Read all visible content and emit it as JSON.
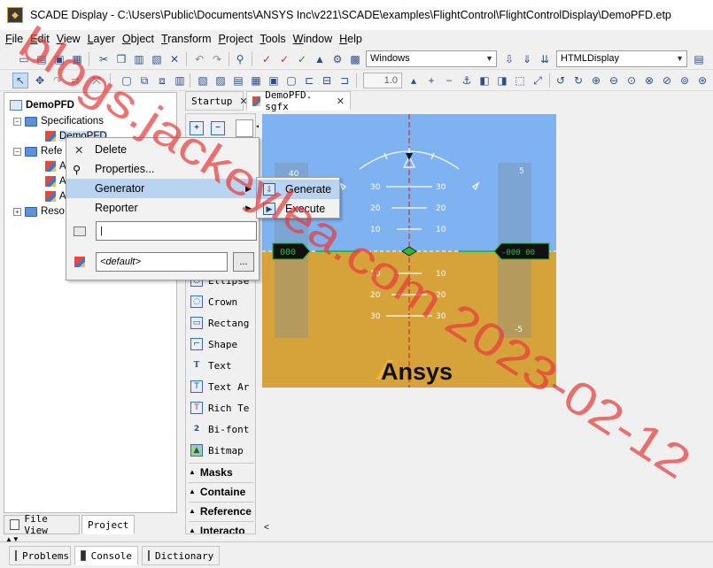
{
  "window": {
    "title": "SCADE Display - C:\\Users\\Public\\Documents\\ANSYS Inc\\v221\\SCADE\\examples\\FlightControl\\FlightControlDisplay\\DemoPFD.etp"
  },
  "menubar": [
    "File",
    "Edit",
    "View",
    "Layer",
    "Object",
    "Transform",
    "Project",
    "Tools",
    "Window",
    "Help"
  ],
  "toolbar": {
    "platform_combo": "Windows",
    "target_combo": "HTMLDisplay",
    "zoom_value": "1.0"
  },
  "project_tree": {
    "root": "DemoPFD",
    "specifications": "Specifications",
    "spec_item": "DemoPFD",
    "references_truncated": "Refe",
    "resources_truncated": "Reso",
    "ref_item_letter": "A"
  },
  "left_tabs": {
    "file_view": "File View",
    "project": "Project"
  },
  "editor_tabs": [
    {
      "label": "Startup"
    },
    {
      "label": "DemoPFD. sgfx"
    }
  ],
  "palette": {
    "items": [
      "Ellipse",
      "Crown",
      "Rectangle",
      "Shape",
      "Text",
      "Text Area",
      "Rich Text",
      "Bi-font",
      "Bitmap"
    ],
    "visible_labels": [
      "Ellipse",
      "Crown",
      "Rectang",
      "Shape",
      "Text",
      "Text Ar",
      "Rich Te",
      "Bi-font",
      "Bitmap"
    ],
    "categories": [
      "Masks",
      "Containe",
      "Reference",
      "Interacto"
    ]
  },
  "context_menu": {
    "delete": "Delete",
    "properties": "Properties...",
    "generator": "Generator",
    "reporter": "Reporter",
    "default_value": "<default>",
    "browse": "..."
  },
  "generator_submenu": {
    "generate": "Generate",
    "execute": "Execute"
  },
  "pfd": {
    "left_box_value": "000",
    "right_box_value": "-000 00",
    "pitch_up_labels": [
      "30",
      "20",
      "10"
    ],
    "pitch_down_labels": [
      "10",
      "20",
      "30"
    ],
    "left_scale_label": "40",
    "right_scale_top": "5",
    "right_scale_bottom": "-5",
    "logo": "Ansys",
    "sky_color": "#7fb2f0",
    "ground_color": "#d6a23a"
  },
  "bottom_tabs": [
    {
      "label": "Problems"
    },
    {
      "label": "Console"
    },
    {
      "label": "Dictionary"
    }
  ],
  "watermark": {
    "text": "blogs.jackeylea.com 2023-02-12"
  }
}
